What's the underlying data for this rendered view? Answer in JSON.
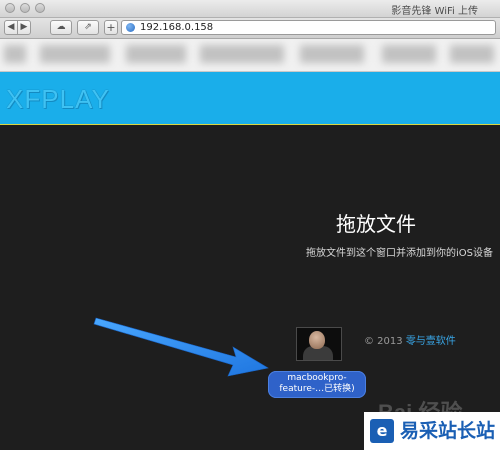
{
  "window": {
    "title": "影音先锋 WiFi 上传"
  },
  "toolbar": {
    "back_glyph": "◀",
    "forward_glyph": "▶",
    "cloud_glyph": "☁",
    "share_glyph": "⇗",
    "add_glyph": "+",
    "url": "192.168.0.158"
  },
  "brand": {
    "name": "XFPLAY",
    "band_color": "#1aaeea"
  },
  "drop_zone": {
    "title": "拖放文件",
    "subtitle": "拖放文件到这个窗口并添加到你的iOS设备"
  },
  "footer": {
    "copyright": "© 2013 ",
    "company_link": "零与壹软件"
  },
  "dragged_file": {
    "line1": "macbookpro-",
    "line2": "feature-…已转换)"
  },
  "watermark": {
    "text": "Bai 经验"
  },
  "site_badge": {
    "logo_glyph": "e",
    "name": "易采站长站"
  },
  "colors": {
    "accent_link": "#39a7e8",
    "arrow": "#2f8ff0",
    "file_label_bg": "#2f62c9"
  }
}
